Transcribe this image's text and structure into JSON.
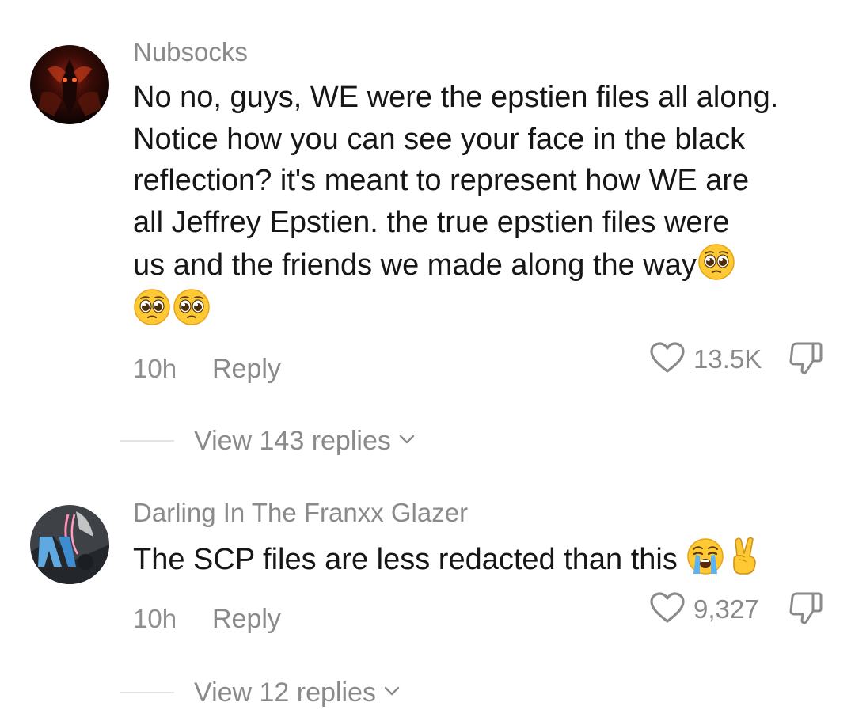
{
  "comments": [
    {
      "username": "Nubsocks",
      "text_lines": [
        "No no, guys, WE were the epstien files all along.",
        "Notice how you can see your face in the black",
        "reflection? it's meant to represent how WE are",
        "all Jeffrey Epstien. the true epstien files were",
        "us and the friends we made along the way"
      ],
      "trailing_emojis": [
        "pleading-face",
        "pleading-face",
        "pleading-face"
      ],
      "time": "10h",
      "reply_label": "Reply",
      "like_count": "13.5K",
      "view_replies": "View 143 replies"
    },
    {
      "username": "Darling In The Franxx Glazer",
      "text": "The SCP files are less redacted than this",
      "trailing_emojis": [
        "loudly-crying-face",
        "victory-hand"
      ],
      "time": "10h",
      "reply_label": "Reply",
      "like_count": "9,327",
      "view_replies": "View 12 replies"
    }
  ],
  "colors": {
    "primary_text": "#161616",
    "secondary_text": "#8a8a8a",
    "divider": "#e3e3e3",
    "emoji_yellow": "#ffc933"
  }
}
